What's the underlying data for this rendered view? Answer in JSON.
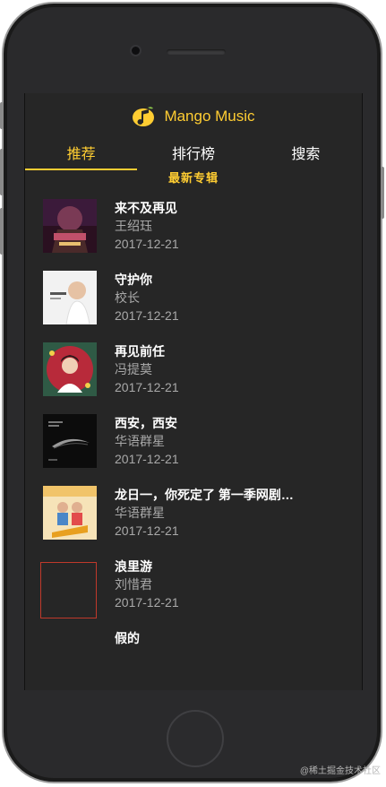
{
  "app": {
    "title": "Mango Music",
    "accent": "#ffcd32",
    "background": "#262626"
  },
  "tabs": [
    {
      "label": "推荐",
      "active": true
    },
    {
      "label": "排行榜",
      "active": false
    },
    {
      "label": "搜索",
      "active": false
    }
  ],
  "section_title": "最新专辑",
  "albums": [
    {
      "name": "来不及再见",
      "singer": "王绍珏",
      "date": "2017-12-21"
    },
    {
      "name": "守护你",
      "singer": "校长",
      "date": "2017-12-21"
    },
    {
      "name": "再见前任",
      "singer": "冯提莫",
      "date": "2017-12-21"
    },
    {
      "name": "西安，西安",
      "singer": "华语群星",
      "date": "2017-12-21"
    },
    {
      "name": "龙日一，你死定了 第一季网剧原声带",
      "singer": "华语群星",
      "date": "2017-12-21"
    },
    {
      "name": "浪里游",
      "singer": "刘惜君",
      "date": "2017-12-21"
    },
    {
      "name": "假的",
      "singer": "",
      "date": ""
    }
  ],
  "watermark": "@稀土掘金技术社区"
}
